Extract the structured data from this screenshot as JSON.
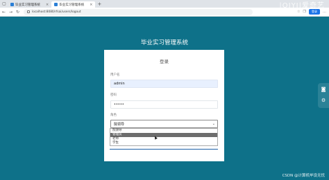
{
  "browser": {
    "tabs": [
      {
        "label": "毕业实习管理系统",
        "active": false
      },
      {
        "label": "毕业实习管理系统",
        "active": true
      }
    ],
    "url": "localhost:8080/rfsai/users/logout",
    "signin_label": "登录"
  },
  "watermark_top": "|OIYI|爱奇艺",
  "page": {
    "title": "毕业实习管理系统",
    "card_title": "登录",
    "username_label": "用户名",
    "username_value": "admin",
    "password_label": "密码",
    "password_value": "•••••",
    "role_label": "角色",
    "role_selected": "院领导",
    "role_options": [
      "院领导",
      "管理员",
      "老师",
      "学生"
    ],
    "role_highlighted_index": 1
  },
  "footer_watermark": "CSDN @计算机毕设无忧",
  "colors": {
    "background": "#0e7189",
    "card": "#ffffff",
    "accent": "#1b5fa6"
  }
}
